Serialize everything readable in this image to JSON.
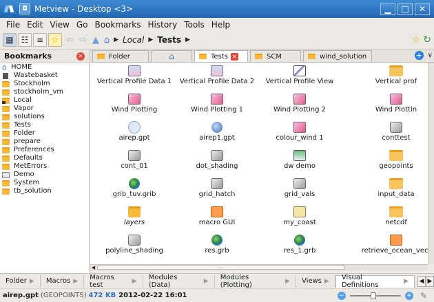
{
  "window": {
    "title": "Metview - Desktop <3>",
    "minimize": "▁",
    "maximize": "□",
    "close": "✕"
  },
  "menu": [
    "File",
    "Edit",
    "View",
    "Go",
    "Bookmarks",
    "History",
    "Tools",
    "Help"
  ],
  "breadcrumb": {
    "local": "Local",
    "tests": "Tests"
  },
  "sidebar": {
    "title": "Bookmarks",
    "items": [
      {
        "label": "HOME",
        "icon": "home-icon"
      },
      {
        "label": "Wastebasket",
        "icon": "trash-icon"
      },
      {
        "label": "Stockholm",
        "icon": "folder-icon"
      },
      {
        "label": "stockholm_vm",
        "icon": "folder-icon"
      },
      {
        "label": "Local",
        "icon": "local-folder-icon"
      },
      {
        "label": "Vapor",
        "icon": "folder-icon"
      },
      {
        "label": "solutions",
        "icon": "folder-icon"
      },
      {
        "label": "Tests",
        "icon": "folder-icon"
      },
      {
        "label": "Folder",
        "icon": "folder-icon"
      },
      {
        "label": "prepare",
        "icon": "folder-icon"
      },
      {
        "label": "Preferences",
        "icon": "folder-icon"
      },
      {
        "label": "Defaults",
        "icon": "folder-icon"
      },
      {
        "label": "MetErrors",
        "icon": "folder-icon"
      },
      {
        "label": "Demo",
        "icon": "network-icon"
      },
      {
        "label": "System",
        "icon": "folder-icon"
      },
      {
        "label": "tb_solution",
        "icon": "folder-icon"
      }
    ]
  },
  "tabs": [
    {
      "label": "Folder"
    },
    {
      "label": ""
    },
    {
      "label": "Tests"
    },
    {
      "label": "SCM"
    },
    {
      "label": "wind_solution"
    }
  ],
  "grid": {
    "rows": [
      [
        {
          "label": "Vertical Profile Data 1",
          "icon": "profile"
        },
        {
          "label": "Vertical Profile Data 2",
          "icon": "profile"
        },
        {
          "label": "Vertical Profile View",
          "icon": "profview"
        },
        {
          "label": "Vertical prof",
          "icon": "folder"
        }
      ],
      [
        {
          "label": "Wind Plotting",
          "icon": "plot"
        },
        {
          "label": "Wind Plotting 1",
          "icon": "plot"
        },
        {
          "label": "Wind Plotting 2",
          "icon": "plot"
        },
        {
          "label": "Wind Plottin",
          "icon": "plot"
        }
      ],
      [
        {
          "label": "airep.gpt",
          "icon": "geo"
        },
        {
          "label": "airep1.gpt",
          "icon": "geo"
        },
        {
          "label": "colour_wind 1",
          "icon": "plot"
        },
        {
          "label": "conttest",
          "icon": "shade"
        }
      ],
      [
        {
          "label": "cont_01",
          "icon": "shade"
        },
        {
          "label": "dot_shading",
          "icon": "shade"
        },
        {
          "label": "dw demo",
          "icon": "dw"
        },
        {
          "label": "geopoints",
          "icon": "folder"
        }
      ],
      [
        {
          "label": "grib_tuv.grib",
          "icon": "globe"
        },
        {
          "label": "grid_hatch",
          "icon": "shade"
        },
        {
          "label": "grid_vals",
          "icon": "shade"
        },
        {
          "label": "input_data",
          "icon": "folder"
        }
      ],
      [
        {
          "label": "layers",
          "icon": "layers"
        },
        {
          "label": "macro GUI",
          "icon": "macro"
        },
        {
          "label": "my_coast",
          "icon": "coast"
        },
        {
          "label": "netcdf",
          "icon": "folder"
        }
      ],
      [
        {
          "label": "polyline_shading",
          "icon": "shade"
        },
        {
          "label": "res.grb",
          "icon": "globe"
        },
        {
          "label": "res_1.grb",
          "icon": "globe"
        },
        {
          "label": "retrieve_ocean_vect",
          "icon": "macro"
        }
      ]
    ]
  },
  "bottom_tabs": [
    "Folder",
    "Macros",
    "Macros test",
    "Modules (Data)",
    "Modules (Plotting)",
    "Views",
    "Visual Definitions"
  ],
  "status": {
    "file": "airep.gpt",
    "type": "(GEOPOINTS)",
    "size": "472 KB",
    "date": "2012-02-22 16:01"
  }
}
